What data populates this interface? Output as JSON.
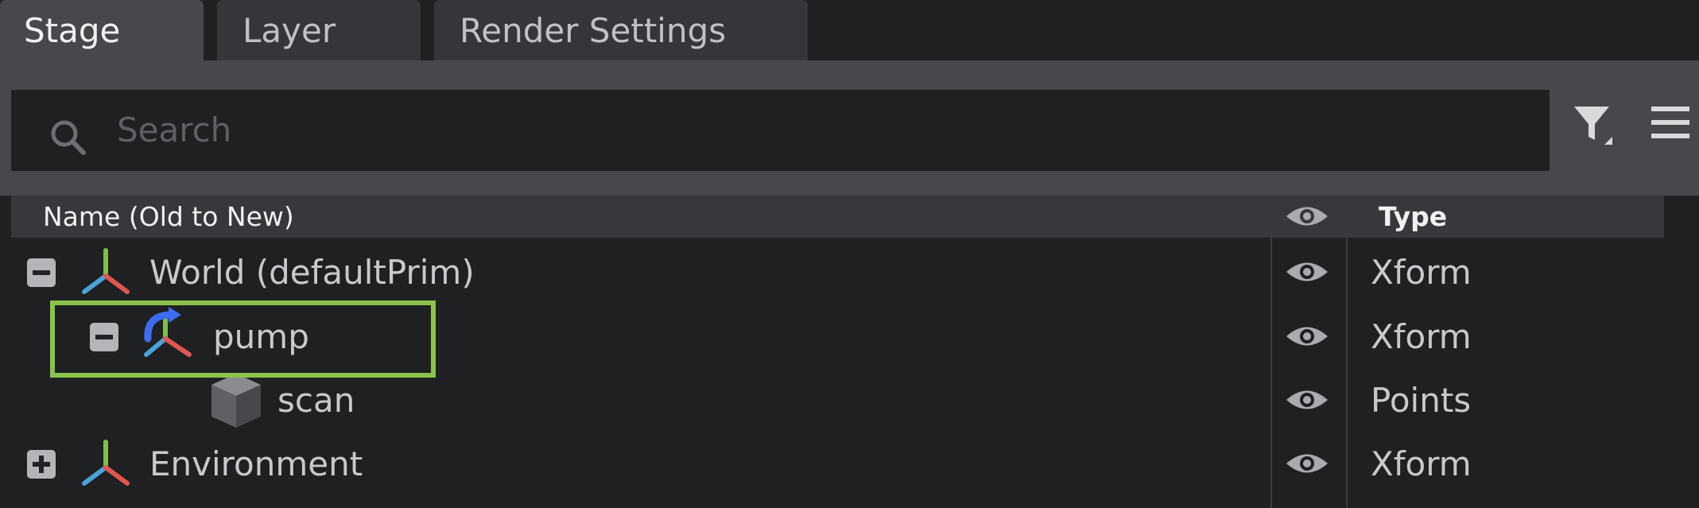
{
  "tabs": [
    {
      "label": "Stage",
      "active": true
    },
    {
      "label": "Layer",
      "active": false
    },
    {
      "label": "Render Settings",
      "active": false
    }
  ],
  "search": {
    "placeholder": "Search"
  },
  "toolbar_icons": [
    "filter-icon",
    "hamburger-menu-icon"
  ],
  "columns": {
    "name": "Name (Old to New)",
    "visibility": "eye-icon",
    "type": "Type"
  },
  "rows": [
    {
      "label": "World (defaultPrim)",
      "type": "Xform",
      "toggle": "collapse",
      "icon": "xform-axis-icon"
    },
    {
      "label": "pump",
      "type": "Xform",
      "toggle": "collapse",
      "icon": "xform-reference-icon",
      "highlighted": true
    },
    {
      "label": "scan",
      "type": "Points",
      "toggle": null,
      "icon": "points-cube-icon"
    },
    {
      "label": "Environment",
      "type": "Xform",
      "toggle": "expand",
      "icon": "xform-axis-icon"
    }
  ],
  "colors": {
    "highlight": "#8bc34a",
    "panel": "#1f2022",
    "toolbar": "#46484c"
  }
}
